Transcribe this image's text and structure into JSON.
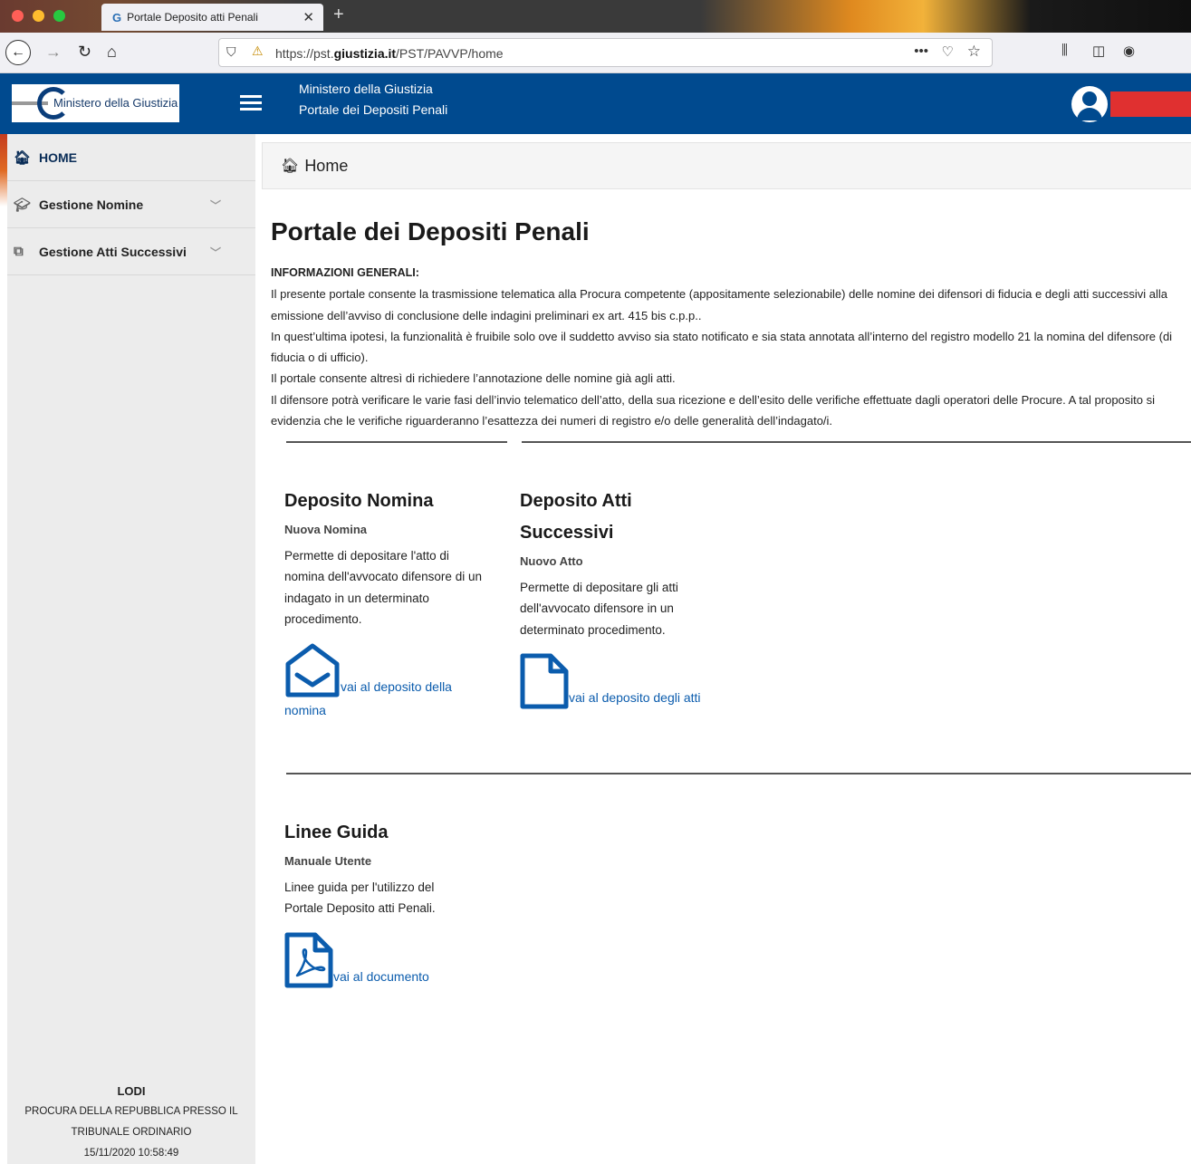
{
  "browser": {
    "tab_title": "Portale Deposito atti Penali",
    "tab_favicon": "G",
    "url_prefix": "https://pst.",
    "url_domain": "giustizia.it",
    "url_path": "/PST/PAVVP/home",
    "more_label": "•••"
  },
  "header": {
    "logo_text": "Ministero della Giustizia",
    "title_line1": "Ministero della Giustizia",
    "title_line2": "Portale dei Depositi Penali"
  },
  "sidebar": {
    "items": [
      {
        "label": "HOME",
        "icon": "home-icon"
      },
      {
        "label": "Gestione Nomine",
        "icon": "graduation-cap-icon"
      },
      {
        "label": "Gestione Atti Successivi",
        "icon": "copy-icon"
      }
    ],
    "footer": {
      "city": "LODI",
      "office_line1": "PROCURA DELLA REPUBBLICA PRESSO IL",
      "office_line2": "TRIBUNALE ORDINARIO",
      "datetime": "15/11/2020 10:58:49"
    }
  },
  "breadcrumb": {
    "label": "Home"
  },
  "main": {
    "title": "Portale dei Depositi Penali",
    "info_label": "INFORMAZIONI GENERALI:",
    "info_paragraphs": [
      "Il presente portale consente la trasmissione telematica alla Procura competente (appositamente selezionabile) delle nomine dei difensori di fiducia e degli atti successivi alla emissione dell’avviso di conclusione delle indagini preliminari ex art. 415 bis c.p.p..",
      "In quest’ultima ipotesi, la funzionalità è fruibile solo ove il suddetto avviso sia stato notificato e sia stata annotata all’interno del registro modello 21 la nomina del difensore (di fiducia o di ufficio).",
      "Il portale consente altresì di richiedere l’annotazione delle nomine già agli atti.",
      "Il difensore potrà verificare le varie fasi dell’invio telematico dell’atto, della sua ricezione e dell’esito delle verifiche effettuate dagli operatori delle Procure. A tal proposito si evidenzia che le verifiche riguarderanno l’esattezza dei numeri di registro e/o delle generalità dell’indagato/i."
    ],
    "cards": [
      {
        "title": "Deposito Nomina",
        "subtitle": "Nuova Nomina",
        "description": "Permette di depositare l'atto di nomina dell'avvocato difensore di un indagato in un determinato procedimento.",
        "link": "vai al deposito della nomina",
        "icon": "envelope-open-icon"
      },
      {
        "title": "Deposito Atti Successivi",
        "subtitle": "Nuovo Atto",
        "description": "Permette di depositare gli atti dell'avvocato difensore in un determinato procedimento.",
        "link": "vai al deposito degli atti",
        "icon": "file-icon"
      },
      {
        "title": "Linee Guida",
        "subtitle": "Manuale Utente",
        "description": "Linee guida per l'utilizzo del Portale Deposito atti Penali.",
        "link": "vai al documento",
        "icon": "file-pdf-icon"
      }
    ]
  },
  "colors": {
    "header_bg": "#004a8f",
    "sidebar_bg": "#ececec",
    "link": "#0b5cad",
    "icon_blue": "#0b5cad"
  }
}
